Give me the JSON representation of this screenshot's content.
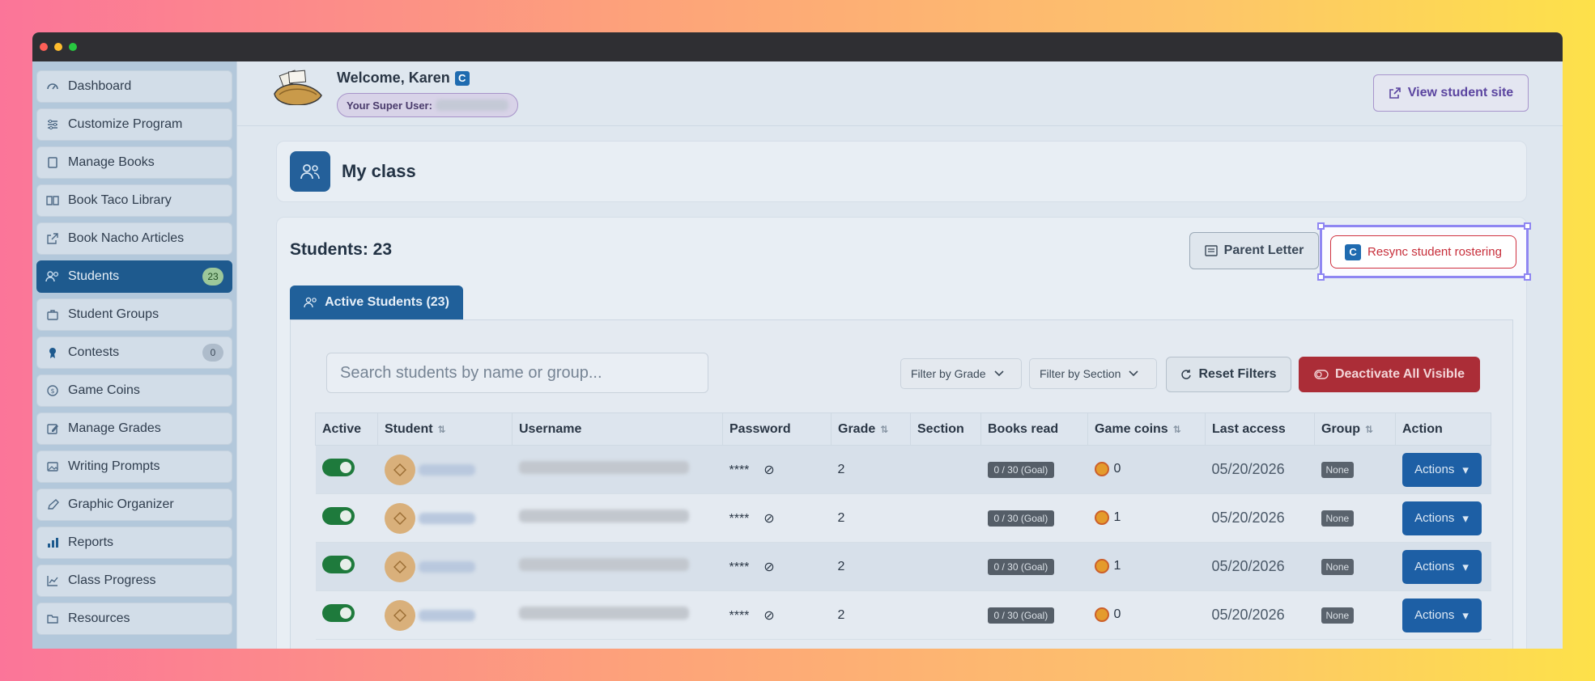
{
  "colors": {
    "brand": "#1e5a8e",
    "danger": "#c72e3a",
    "accent": "#5b45a0",
    "success": "#1e7a3c"
  },
  "sidebar": {
    "items": [
      {
        "label": "Dashboard",
        "icon": "gauge-icon"
      },
      {
        "label": "Customize Program",
        "icon": "sliders-icon"
      },
      {
        "label": "Manage Books",
        "icon": "book-icon"
      },
      {
        "label": "Book Taco Library",
        "icon": "open-book-icon"
      },
      {
        "label": "Book Nacho Articles",
        "icon": "external-link-icon"
      },
      {
        "label": "Students",
        "icon": "users-icon",
        "badge": "23",
        "active": true
      },
      {
        "label": "Student Groups",
        "icon": "briefcase-icon"
      },
      {
        "label": "Contests",
        "icon": "ribbon-icon",
        "badge": "0"
      },
      {
        "label": "Game Coins",
        "icon": "coin-icon"
      },
      {
        "label": "Manage Grades",
        "icon": "edit-icon"
      },
      {
        "label": "Writing Prompts",
        "icon": "image-icon"
      },
      {
        "label": "Graphic Organizer",
        "icon": "pen-icon"
      },
      {
        "label": "Reports",
        "icon": "bar-chart-icon"
      },
      {
        "label": "Class Progress",
        "icon": "line-chart-icon"
      },
      {
        "label": "Resources",
        "icon": "folder-icon"
      }
    ]
  },
  "header": {
    "welcome": "Welcome, Karen",
    "c_badge": "C",
    "super_user_label": "Your Super User:",
    "view_site": "View student site"
  },
  "page": {
    "title": "My class",
    "students_count": "Students: 23",
    "parent_letter": "Parent Letter",
    "resync": "Resync student rostering",
    "tab": "Active Students (23)"
  },
  "toolbar": {
    "search_placeholder": "Search students by name or group...",
    "filter_grade": "Filter by Grade",
    "filter_section": "Filter by Section",
    "reset": "Reset Filters",
    "deactivate": "Deactivate All Visible"
  },
  "table": {
    "headers": [
      "Active",
      "Student",
      "Username",
      "Password",
      "Grade",
      "Section",
      "Books read",
      "Game coins",
      "Last access",
      "Group",
      "Action"
    ],
    "rows": [
      {
        "password": "****",
        "grade": "2",
        "section": "",
        "books": "0 / 30 (Goal)",
        "coins": "0",
        "last_access": "05/20/2026",
        "group": "None",
        "action": "Actions"
      },
      {
        "password": "****",
        "grade": "2",
        "section": "",
        "books": "0 / 30 (Goal)",
        "coins": "1",
        "last_access": "05/20/2026",
        "group": "None",
        "action": "Actions"
      },
      {
        "password": "****",
        "grade": "2",
        "section": "",
        "books": "0 / 30 (Goal)",
        "coins": "1",
        "last_access": "05/20/2026",
        "group": "None",
        "action": "Actions"
      },
      {
        "password": "****",
        "grade": "2",
        "section": "",
        "books": "0 / 30 (Goal)",
        "coins": "0",
        "last_access": "05/20/2026",
        "group": "None",
        "action": "Actions"
      }
    ]
  }
}
